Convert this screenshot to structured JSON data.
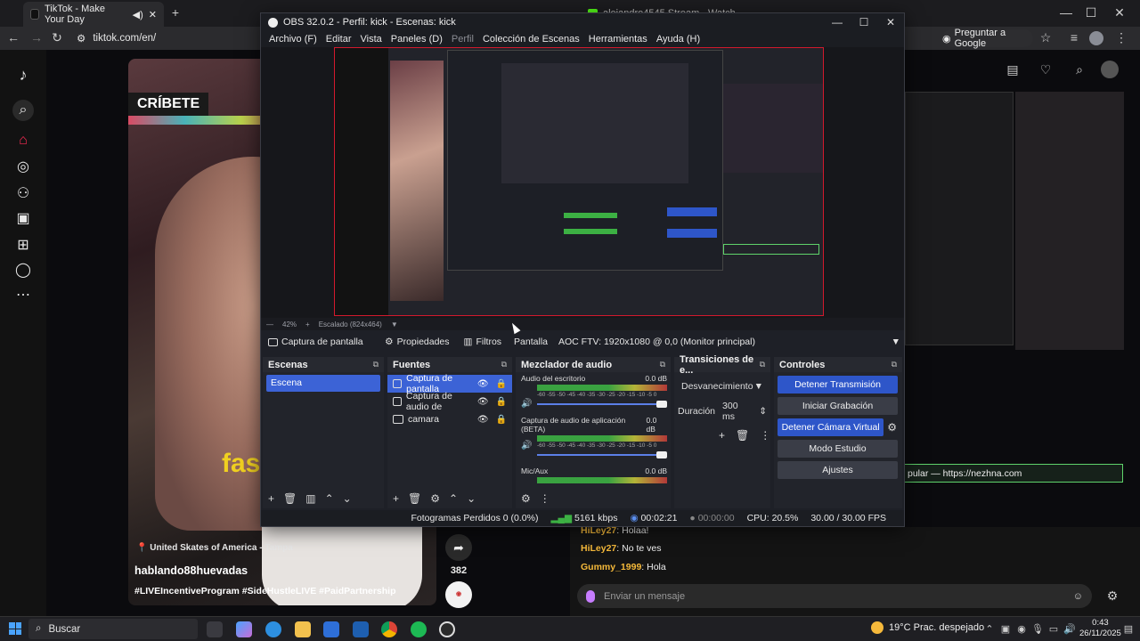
{
  "browser": {
    "active_tab": "TikTok - Make Your Day",
    "second_tab": "alejandro4545 Stream - Watch",
    "url": "tiktok.com/en/",
    "ask_google": "Preguntar a Google"
  },
  "tiktok": {
    "overlay_text": "CRÍBETE",
    "caption_word": "fas",
    "location": "United Skates of America - Tampa",
    "username": "hablando88huevadas",
    "hashtags": "#LIVEIncentiveProgram #SideHustleLIVE #PaidPartnership",
    "share_count": "382"
  },
  "chat": {
    "messages": [
      {
        "user": "HiLey27",
        "text": ": Holaa!"
      },
      {
        "user": "HiLey27",
        "text": ": No te ves"
      },
      {
        "user": "Gummy_1999",
        "text": ": Hola"
      }
    ],
    "input_placeholder": "Enviar un mensaje",
    "promo_text": "pular — https://nezhna.com"
  },
  "obs": {
    "title": "OBS 32.0.2 - Perfil: kick - Escenas: kick",
    "menu": [
      "Archivo (F)",
      "Editar",
      "Vista",
      "Paneles (D)",
      "Perfil",
      "Colección de Escenas",
      "Herramientas",
      "Ayuda (H)"
    ],
    "zoom": "42%",
    "scaled": "Escalado (824x464)",
    "source_bar": {
      "selected": "Captura de pantalla",
      "properties": "Propiedades",
      "filters": "Filtros",
      "screen_label": "Pantalla",
      "screen_value": "AOC FTV: 1920x1080 @ 0,0 (Monitor principal)"
    },
    "docks": {
      "scenes_title": "Escenas",
      "scene": "Escena",
      "sources_title": "Fuentes",
      "sources": [
        "Captura de pantalla",
        "Captura de audio de",
        "camara"
      ],
      "mixer_title": "Mezclador de audio",
      "mixer": [
        {
          "name": "Audio del escritorio",
          "db": "0.0 dB"
        },
        {
          "name": "Captura de audio de aplicación (BETA)",
          "db": "0.0 dB"
        },
        {
          "name": "Mic/Aux",
          "db": "0.0 dB"
        }
      ],
      "mixer_scale": "-60 -55 -50 -45 -40 -35 -30 -25 -20 -15 -10 -5 0",
      "transitions_title": "Transiciones de e...",
      "transition": "Desvanecimiento",
      "duration_label": "Duración",
      "duration_value": "300 ms",
      "controls_title": "Controles",
      "controls": [
        "Detener Transmisión",
        "Iniciar Grabación",
        "Detener Cámara Virtual",
        "Modo Estudio",
        "Ajustes"
      ]
    },
    "status": {
      "dropped": "Fotogramas Perdidos 0 (0.0%)",
      "bitrate": "5161 kbps",
      "stream_time": "00:02:21",
      "rec_time": "00:00:00",
      "cpu": "CPU: 20.5%",
      "fps": "30.00 / 30.00 FPS"
    }
  },
  "taskbar": {
    "search": "Buscar",
    "weather": "19°C  Prac. despejado",
    "time": "0:43",
    "date": "26/11/2025"
  },
  "colors": {
    "accent_blue": "#2e56c9",
    "selection_blue": "#3c63d6",
    "preview_border": "#d3192d",
    "chat_user": "#f5b93a"
  }
}
